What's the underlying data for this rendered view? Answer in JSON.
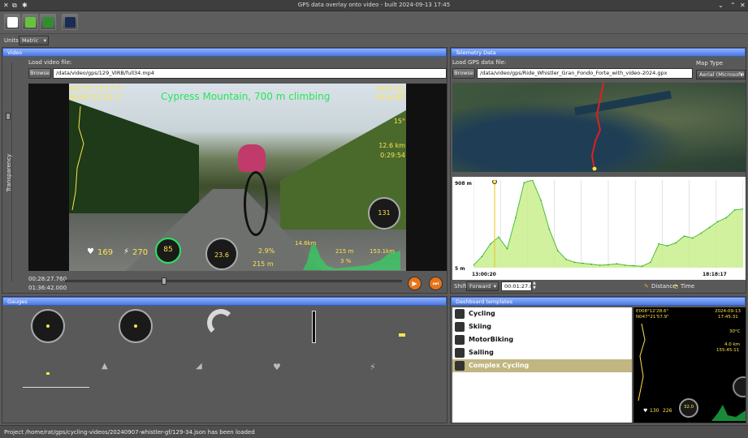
{
  "window": {
    "title": "GPS data overlay onto video - built 2024-09-13 17:45"
  },
  "toolbar": {
    "buttons": [
      "new-project-icon",
      "open-folder-icon",
      "save-icon",
      "render-video-icon"
    ]
  },
  "units": {
    "label": "Units",
    "value": "Metric"
  },
  "video": {
    "header": "Video",
    "load_label": "Load video file:",
    "browse": "Browse",
    "path": "/data/video/gps/129_VIRB/full34.mp4",
    "transparency": "Transparency",
    "time_current": "00:28:27.760",
    "time_total": "01:36:42.000",
    "overlay": {
      "coords": "W123°13'17.7\"\nN049°21'02.2\"",
      "caption": "Cypress Mountain, 700 m climbing",
      "date": "2024-09-07",
      "time": "09:49:17",
      "temp": "15°",
      "dist": "12.6 km",
      "elapsed": "0:29:54",
      "heart": "169",
      "power": "270",
      "cadence": "85",
      "speed": "23.6",
      "grade": "2.9%",
      "alt1": "215 m",
      "alt2": "215 m",
      "grade2": "3 %",
      "seg_dist": "14.6km",
      "total_dist": "153.1km",
      "gauge_right": "131"
    }
  },
  "telemetry": {
    "header": "Telemetry Data",
    "load_label": "Load GPS data file:",
    "browse": "Browse",
    "path": "/data/video/gps/Ride_Whistler_Gran_Fondo_Forte_with_video-2024.gpx",
    "map_type_label": "Map Type",
    "map_type": "Aerial (Microsoft)",
    "chart_max": "908 m",
    "chart_min": "5 m",
    "chart_start": "13:00:20",
    "chart_end": "18:18:17",
    "shift_label": "Shift",
    "shift_dir": "Forward",
    "shift_value": "00:01:27.000",
    "distance_label": "Distance",
    "time_label": "Time"
  },
  "chart_data": {
    "type": "area",
    "title": "",
    "xlabel": "",
    "ylabel": "",
    "x_range": [
      "13:00:20",
      "18:18:17"
    ],
    "ylim": [
      5,
      908
    ],
    "series": [
      {
        "values": [
          30,
          120,
          250,
          320,
          200,
          520,
          880,
          908,
          700,
          400,
          180,
          90,
          60,
          50,
          40,
          30,
          35,
          45,
          30,
          25,
          20,
          60,
          250,
          230,
          260,
          330,
          310,
          360,
          420,
          480,
          520,
          600,
          610
        ]
      }
    ]
  },
  "gauges": {
    "header": "Gauges",
    "items": [
      "speed-gauge",
      "speed-gauge-2",
      "power-arc-gauge",
      "vertical-bar-gauge",
      "cadence-label",
      "mountain-icon",
      "grade-gauge",
      "heart-icon",
      "lightning-icon"
    ]
  },
  "templates": {
    "header": "Dashboard templates",
    "items": [
      "Cycling",
      "Skiing",
      "MotorBiking",
      "Sailing",
      "Complex Cycling"
    ],
    "selected": 4,
    "preview": {
      "coords": "E008°12'28.6\"\nN047°21'57.9\"",
      "date": "2024-09-13",
      "time": "17:45:31",
      "temp": "30°C",
      "dist": "4.0 km",
      "elapsed": "155:45:11",
      "heart": "130",
      "power": "226",
      "speed": "32.0"
    }
  },
  "status": "Project /home/rat/gps/cycling-videos/20240907-whistler-gf/129-34.json has been loaded",
  "colors": {
    "header_blue": "#5c86ec",
    "overlay_yellow": "#ffe34d",
    "overlay_green": "#27e55d",
    "selected_row": "#c1b681",
    "track_red": "#e02020"
  }
}
